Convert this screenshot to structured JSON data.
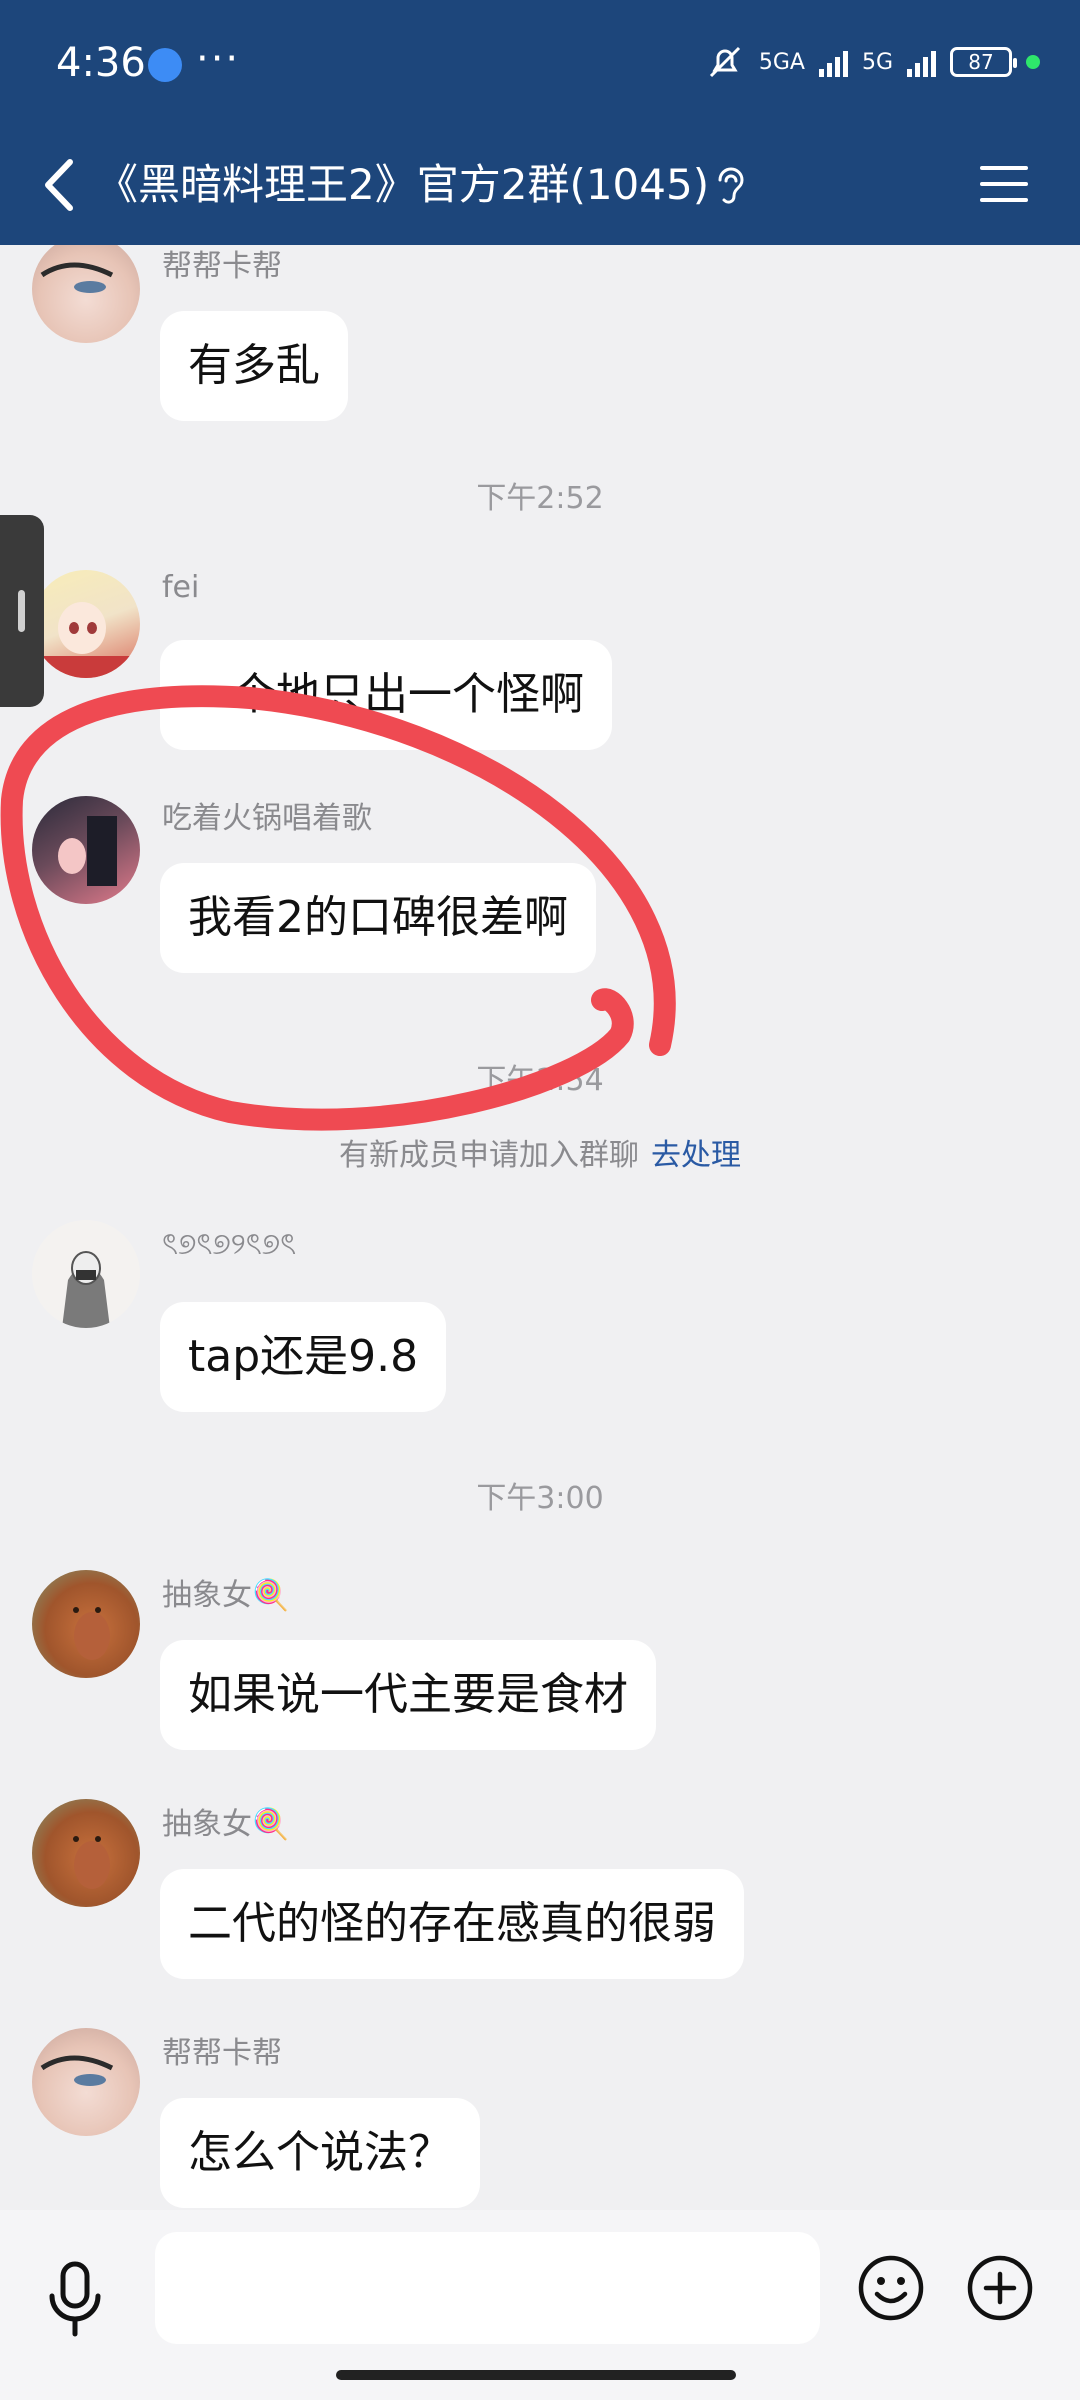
{
  "status_bar": {
    "time": "4:36",
    "dots": "···",
    "network_1": "5GA",
    "network_2": "5G",
    "battery": "87"
  },
  "nav": {
    "title": "《黑暗料理王2》官方2群(1045)"
  },
  "messages": [
    {
      "sender": "帮帮卡帮",
      "text": "有多乱"
    },
    {
      "sender": "fei",
      "text": "一个地只出一个怪啊"
    },
    {
      "sender": "吃着火锅唱着歌",
      "text": "我看2的口碑很差啊"
    },
    {
      "sender": "ৎ୭ৎ୭୨ৎ୭ৎ",
      "text": "tap还是9.8"
    },
    {
      "sender": "抽象女🍭",
      "text": "如果说一代主要是食材"
    },
    {
      "sender": "抽象女🍭",
      "text": "二代的怪的存在感真的很弱"
    },
    {
      "sender": "帮帮卡帮",
      "text": "怎么个说法？"
    }
  ],
  "time_separators": [
    "下午2:52",
    "下午2:54",
    "下午3:00"
  ],
  "system_notice": {
    "text": "有新成员申请加入群聊",
    "action": "去处理"
  },
  "colors": {
    "header_bg": "#1d467b",
    "chat_bg": "#f0f0f2",
    "annotation": "#ef4a52",
    "link": "#2a5aa4"
  },
  "icons": {
    "back": "chevron-left-icon",
    "hearing": "ear-icon",
    "menu": "hamburger-menu-icon",
    "mic": "microphone-icon",
    "emoji": "smiley-icon",
    "add": "plus-circle-icon"
  }
}
